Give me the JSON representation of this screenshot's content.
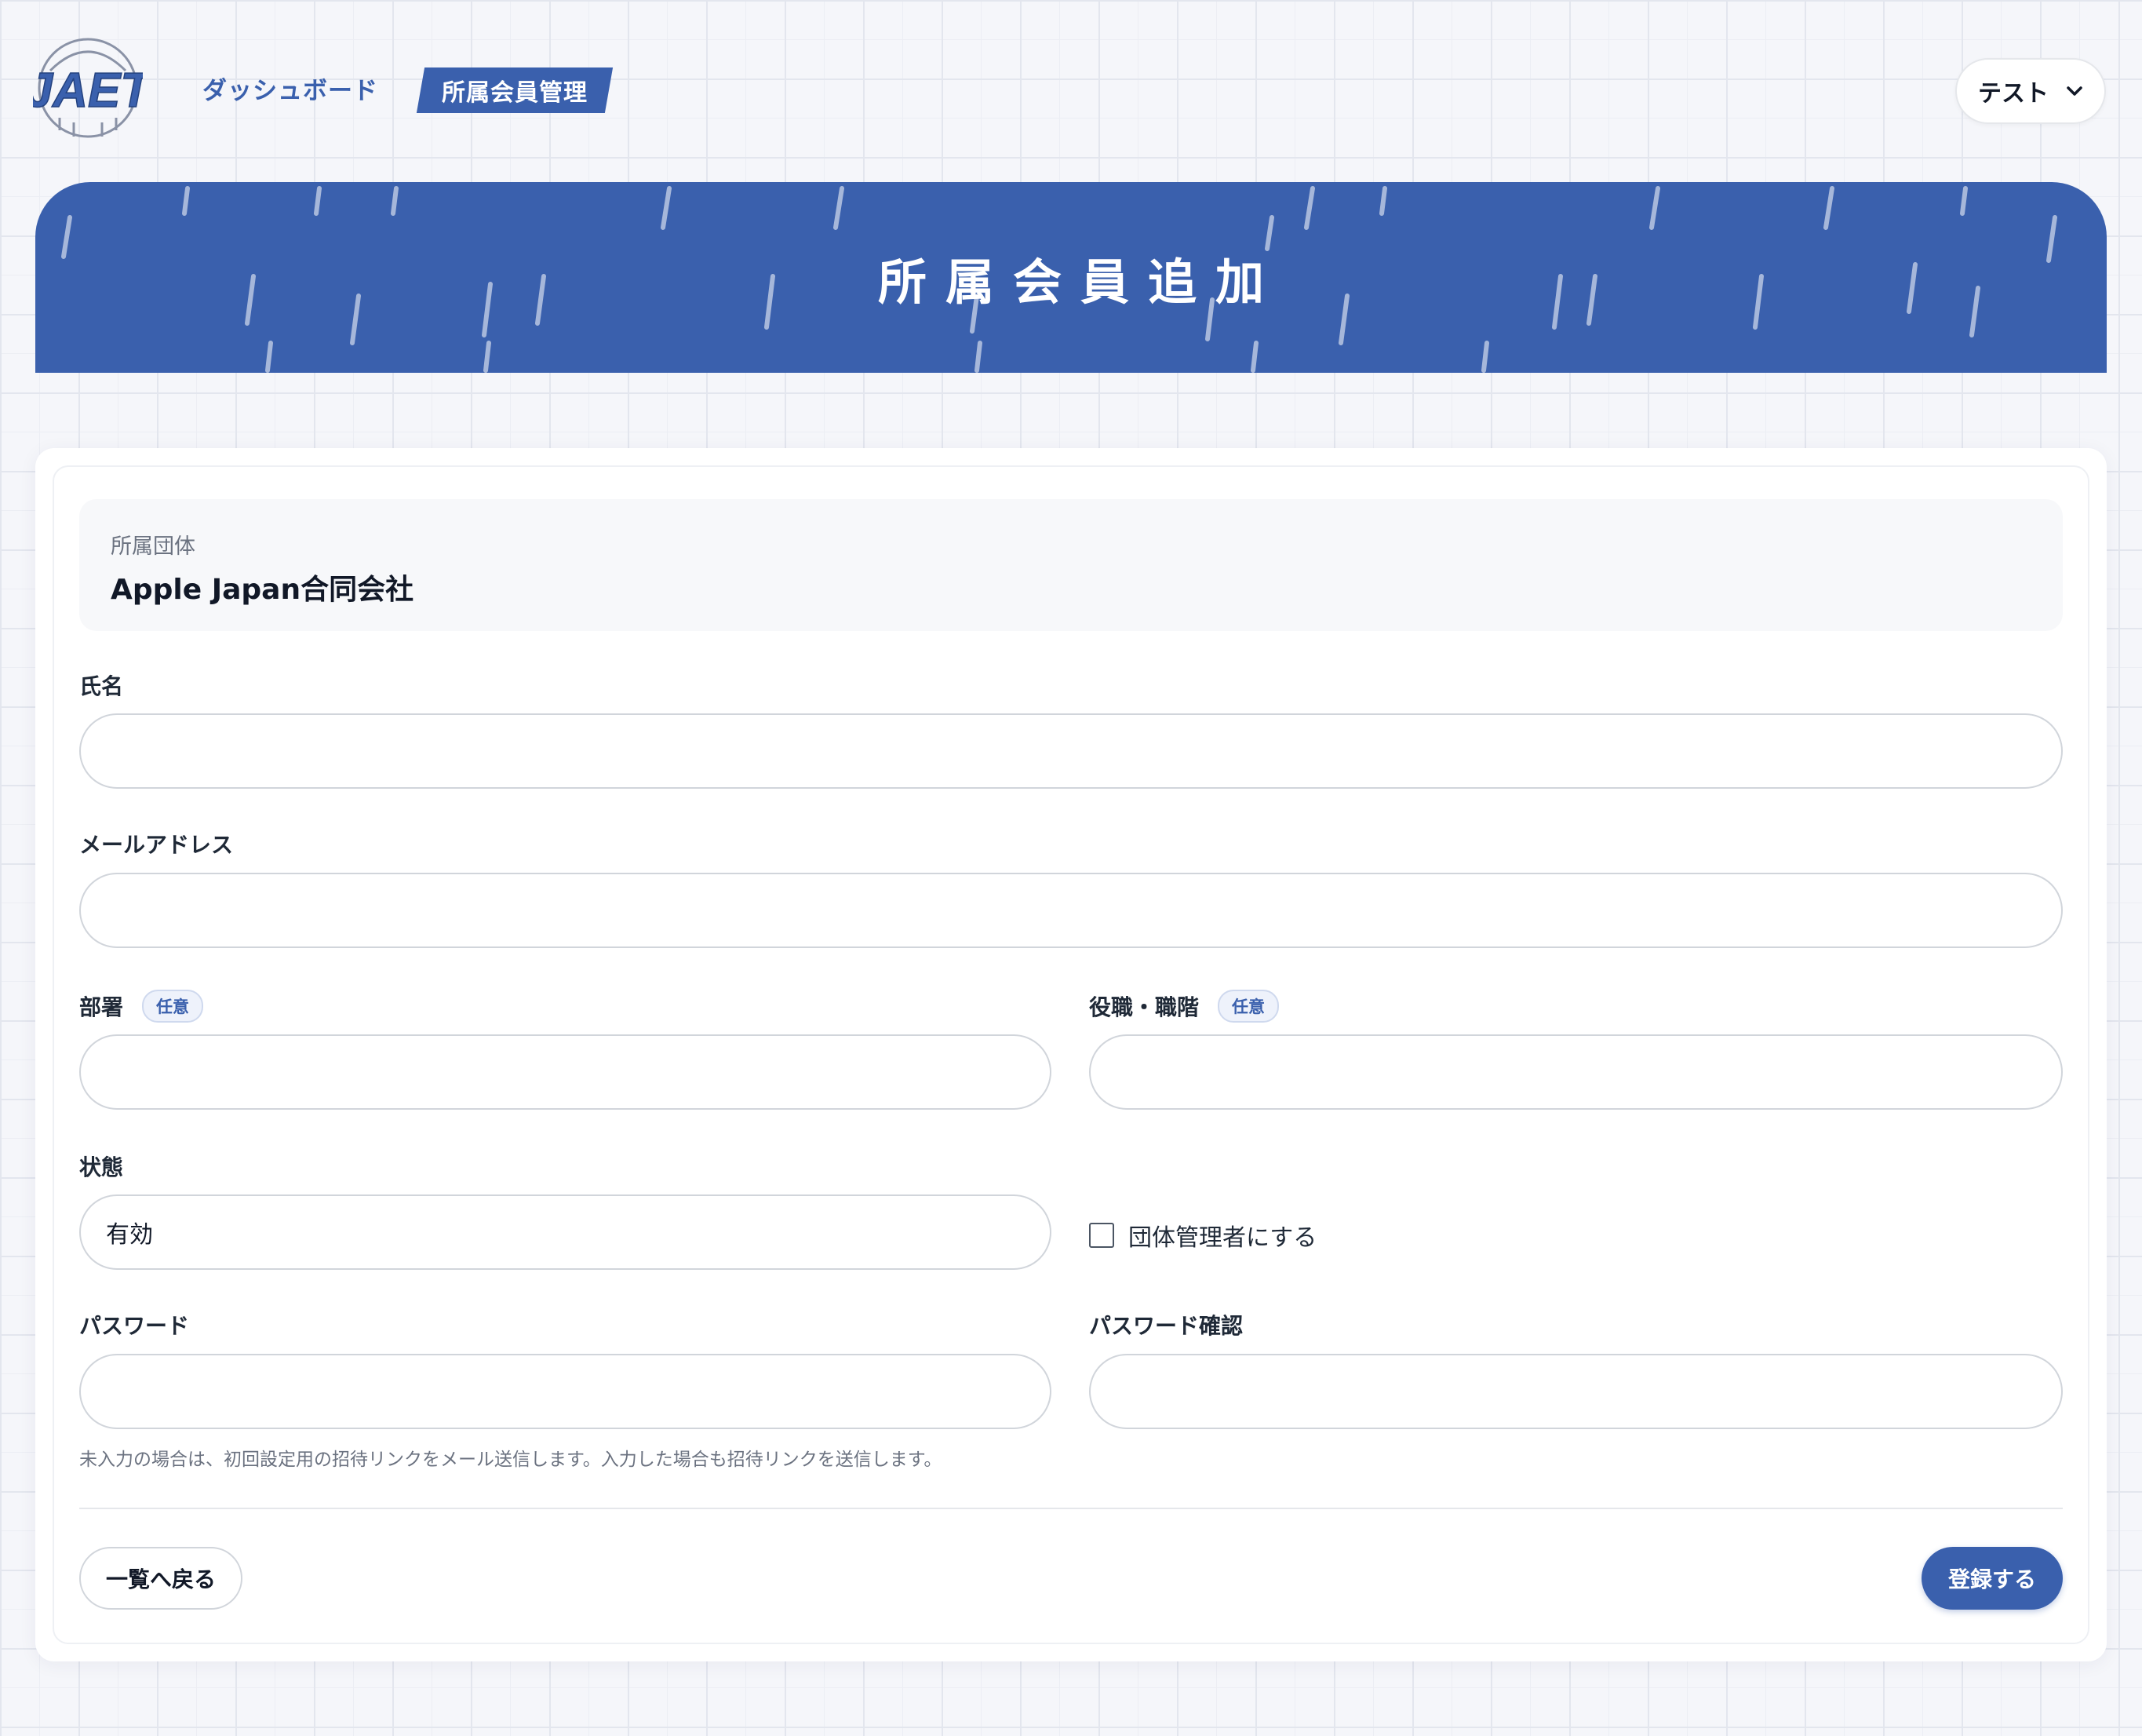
{
  "header": {
    "logo_text": "JAET",
    "nav": [
      {
        "label": "ダッシュボード",
        "active": false
      },
      {
        "label": "所属会員管理",
        "active": true
      }
    ],
    "user_menu": {
      "label": "テスト",
      "icon": "chevron-down-icon"
    }
  },
  "banner": {
    "title": "所属会員追加"
  },
  "form": {
    "organization": {
      "label": "所属団体",
      "value": "Apple Japan合同会社"
    },
    "name": {
      "label": "氏名",
      "value": ""
    },
    "email": {
      "label": "メールアドレス",
      "value": ""
    },
    "department": {
      "label": "部署",
      "badge": "任意",
      "value": ""
    },
    "position": {
      "label": "役職・職階",
      "badge": "任意",
      "value": ""
    },
    "status": {
      "label": "状態",
      "value": "有効"
    },
    "admin_checkbox": {
      "label": "団体管理者にする",
      "checked": false
    },
    "password": {
      "label": "パスワード",
      "value": ""
    },
    "password_confirm": {
      "label": "パスワード確認",
      "value": ""
    },
    "help_text": "未入力の場合は、初回設定用の招待リンクをメール送信します。入力した場合も招待リンクを送信します。",
    "back_label": "一覧へ戻る",
    "submit_label": "登録する"
  },
  "colors": {
    "primary": "#3a60ad",
    "background": "#f5f6fa",
    "border": "#d1d5db"
  }
}
